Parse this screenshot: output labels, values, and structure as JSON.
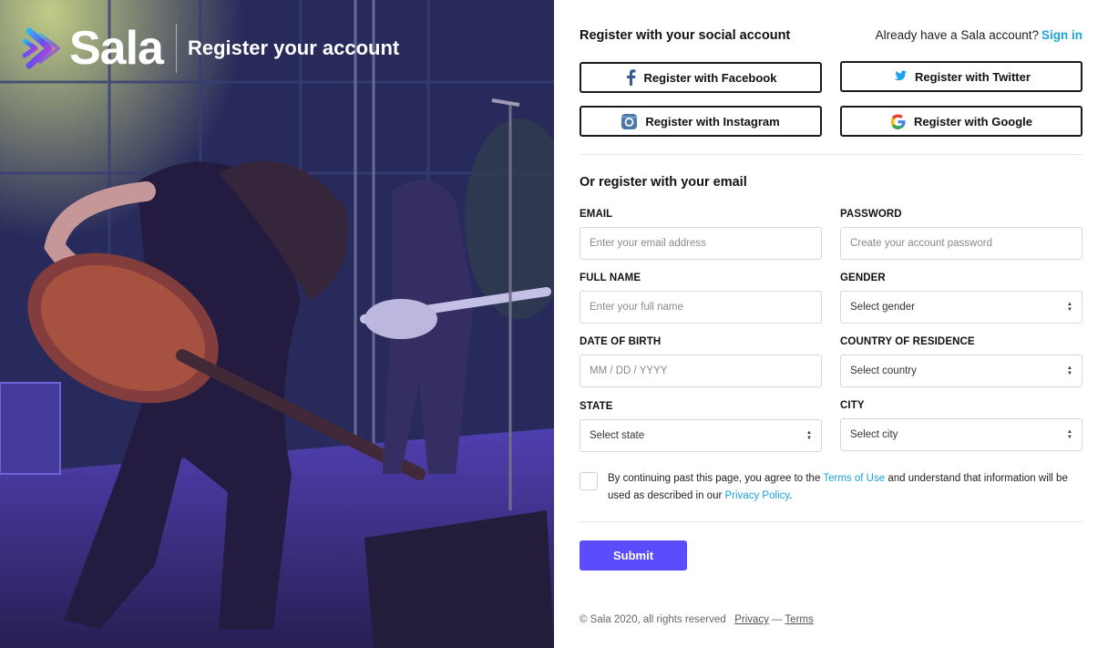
{
  "hero": {
    "brand": "Sala",
    "title": "Register your account"
  },
  "social": {
    "heading": "Register with your social account",
    "signin_prompt": "Already have a Sala account?",
    "signin_link": "Sign in",
    "facebook": "Register with Facebook",
    "twitter": "Register with Twitter",
    "instagram": "Register with Instagram",
    "google": "Register with Google"
  },
  "email_section": {
    "heading": "Or register with your email"
  },
  "form": {
    "email": {
      "label": "EMAIL",
      "placeholder": "Enter your email address"
    },
    "password": {
      "label": "PASSWORD",
      "placeholder": "Create your account password"
    },
    "full_name": {
      "label": "FULL NAME",
      "placeholder": "Enter your full name"
    },
    "gender": {
      "label": "GENDER",
      "value": "Select gender"
    },
    "dob": {
      "label": "DATE OF BIRTH",
      "placeholder": "MM / DD / YYYY"
    },
    "country": {
      "label": "COUNTRY OF RESIDENCE",
      "value": "Select country"
    },
    "state": {
      "label": "STATE",
      "value": "Select state"
    },
    "city": {
      "label": "CITY",
      "value": "Select city"
    }
  },
  "consent": {
    "text_before": "By continuing past this page, you agree to the",
    "terms_link": "Terms of Use",
    "text_middle": "and understand that information will be used as described in our",
    "privacy_link": "Privacy Policy",
    "text_after": "."
  },
  "submit_label": "Submit",
  "footer": {
    "copyright": "© Sala 2020, all rights reserved",
    "privacy": "Privacy",
    "separator": "—",
    "terms": "Terms"
  },
  "colors": {
    "accent": "#5b4dfb",
    "link": "#1aa3e0",
    "facebook": "#3b5998",
    "twitter": "#1da1f2",
    "instagram": "#4a78a8"
  },
  "icons": {
    "brand": "sala-chevrons-icon",
    "facebook": "facebook-icon",
    "twitter": "twitter-icon",
    "instagram": "instagram-icon",
    "google": "google-icon"
  }
}
